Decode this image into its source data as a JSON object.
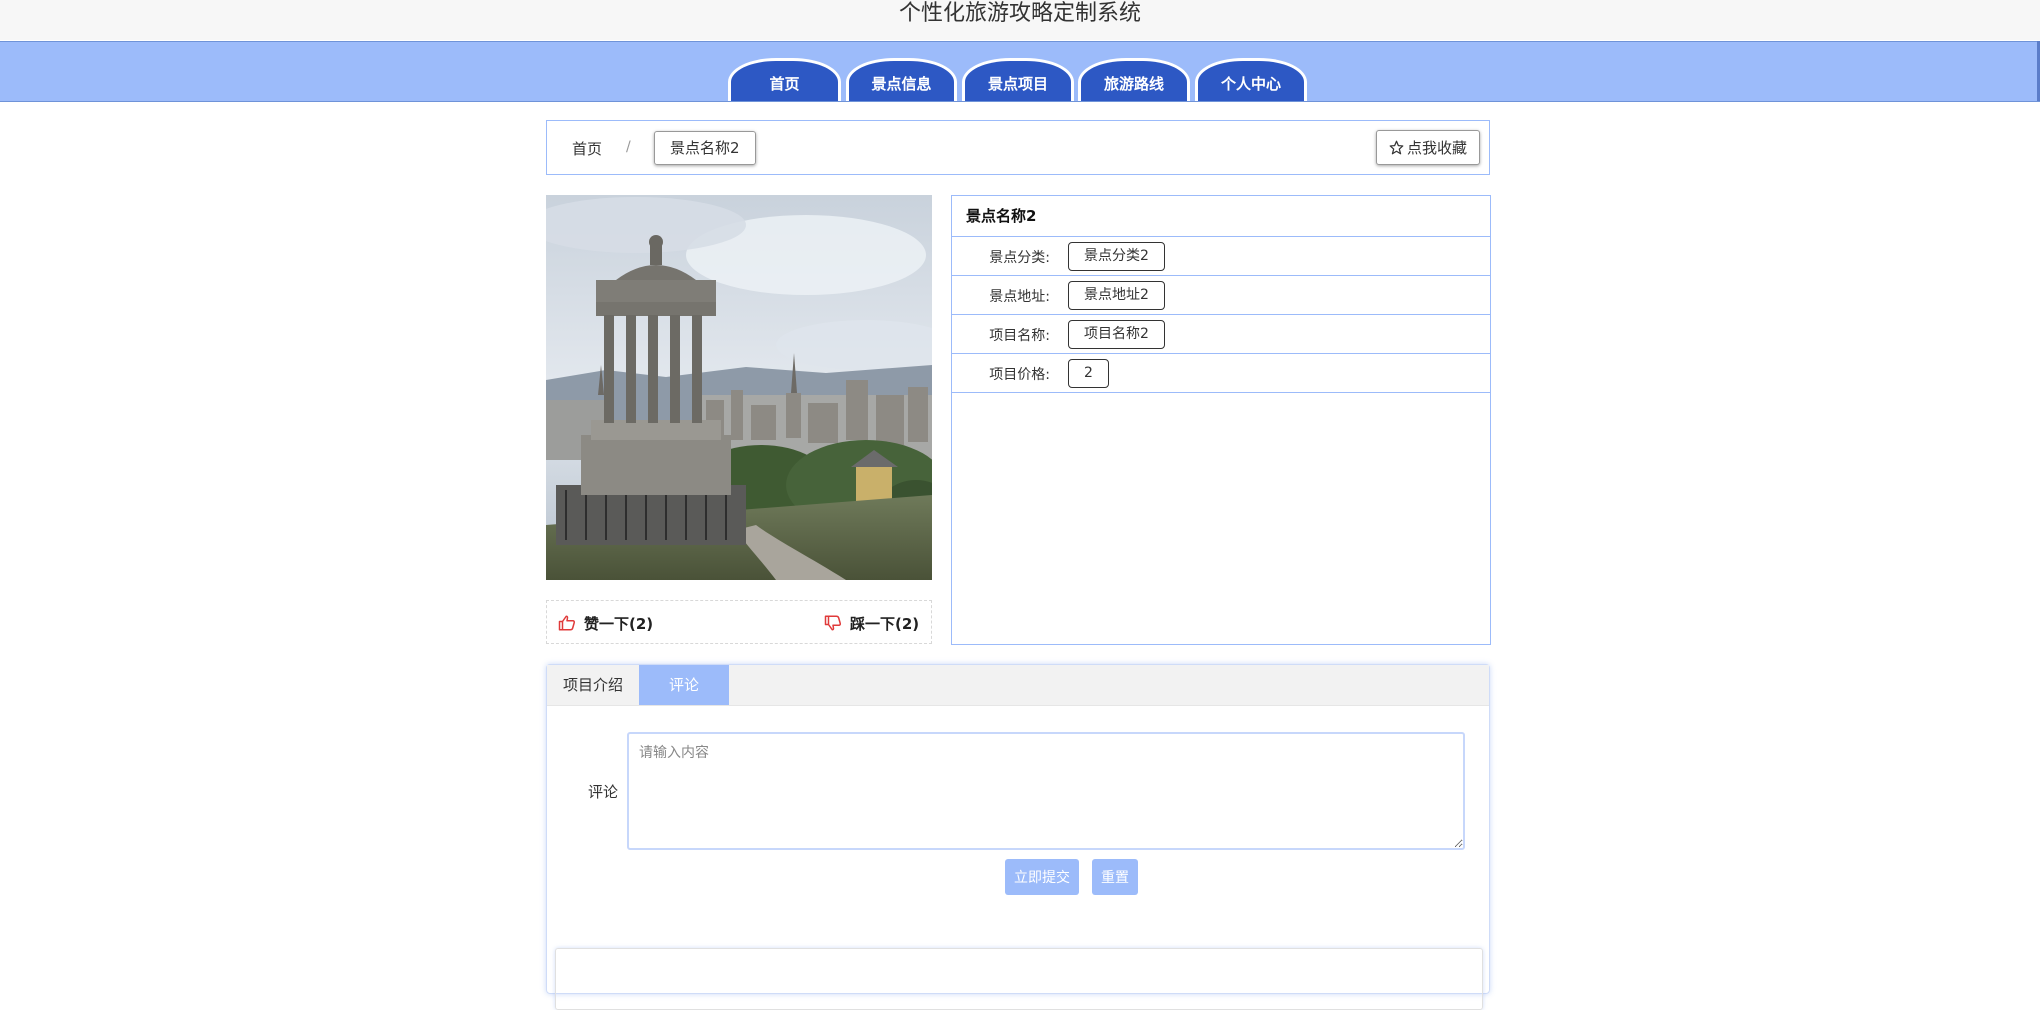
{
  "app": {
    "title": "个性化旅游攻略定制系统"
  },
  "nav": {
    "items": [
      {
        "label": "首页"
      },
      {
        "label": "景点信息"
      },
      {
        "label": "景点项目"
      },
      {
        "label": "旅游路线"
      },
      {
        "label": "个人中心"
      }
    ]
  },
  "breadcrumb": {
    "home": "首页",
    "separator": "/",
    "current": "景点名称2"
  },
  "favorite": {
    "icon": "star-outline-icon",
    "label": "点我收藏"
  },
  "votes": {
    "like_icon": "thumbs-up-icon",
    "like_label": "赞一下(2)",
    "dislike_icon": "thumbs-down-icon",
    "dislike_label": "踩一下(2)"
  },
  "info": {
    "title": "景点名称2",
    "rows": [
      {
        "label": "景点分类:",
        "value": "景点分类2"
      },
      {
        "label": "景点地址:",
        "value": "景点地址2"
      },
      {
        "label": "项目名称:",
        "value": "项目名称2"
      },
      {
        "label": "项目价格:",
        "value": "2"
      }
    ]
  },
  "tabs": [
    {
      "label": "项目介绍"
    },
    {
      "label": "评论",
      "active": true
    }
  ],
  "comment": {
    "label": "评论",
    "placeholder": "请输入内容",
    "submit_label": "立即提交",
    "reset_label": "重置"
  },
  "colors": {
    "accent": "#9cbbfa",
    "nav_tab": "#2d58c4",
    "icon_red": "#e03a3a"
  }
}
